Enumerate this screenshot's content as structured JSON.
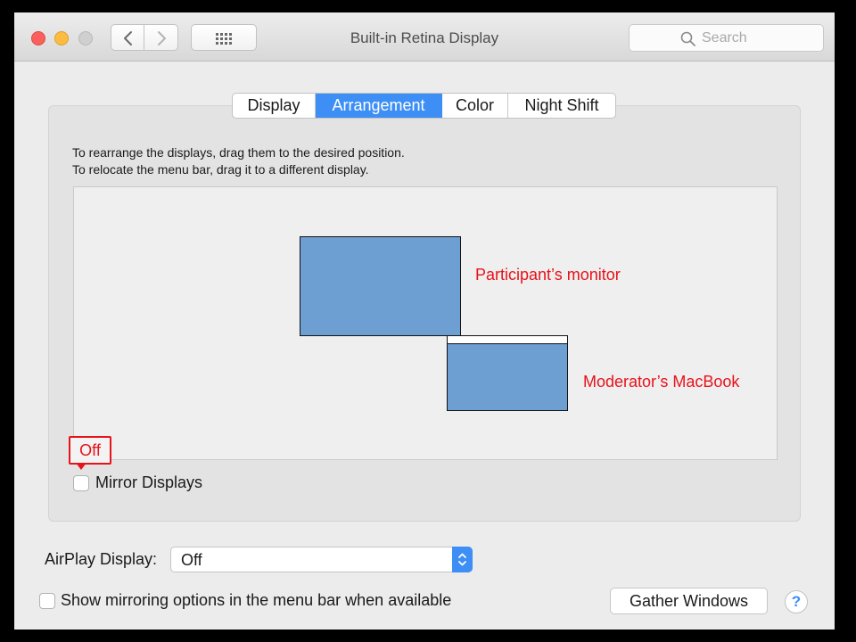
{
  "window": {
    "title": "Built-in Retina Display"
  },
  "toolbar": {
    "search_placeholder": "Search",
    "back_icon": "chevron-left-icon",
    "forward_icon": "chevron-right-icon",
    "show_all_icon": "grid-icon"
  },
  "tabs": [
    {
      "label": "Display",
      "active": false
    },
    {
      "label": "Arrangement",
      "active": true
    },
    {
      "label": "Color",
      "active": false
    },
    {
      "label": "Night Shift",
      "active": false
    }
  ],
  "arrangement": {
    "instruction_line1": "To rearrange the displays, drag them to the desired position.",
    "instruction_line2": "To relocate the menu bar, drag it to a different display.",
    "displays": [
      {
        "annotation": "Participant’s monitor",
        "has_menu_bar": false
      },
      {
        "annotation": "Moderator’s MacBook",
        "has_menu_bar": true
      }
    ],
    "mirror_callout": "Off",
    "mirror_label": "Mirror Displays",
    "mirror_checked": false
  },
  "airplay": {
    "label": "AirPlay Display:",
    "value": "Off"
  },
  "footer": {
    "show_mirroring_label": "Show mirroring options in the menu bar when available",
    "show_mirroring_checked": false,
    "gather_button": "Gather Windows",
    "help_label": "?"
  },
  "colors": {
    "accent": "#3d8ef5",
    "display_fill": "#6e9fd3",
    "annotation": "#e8121b"
  }
}
